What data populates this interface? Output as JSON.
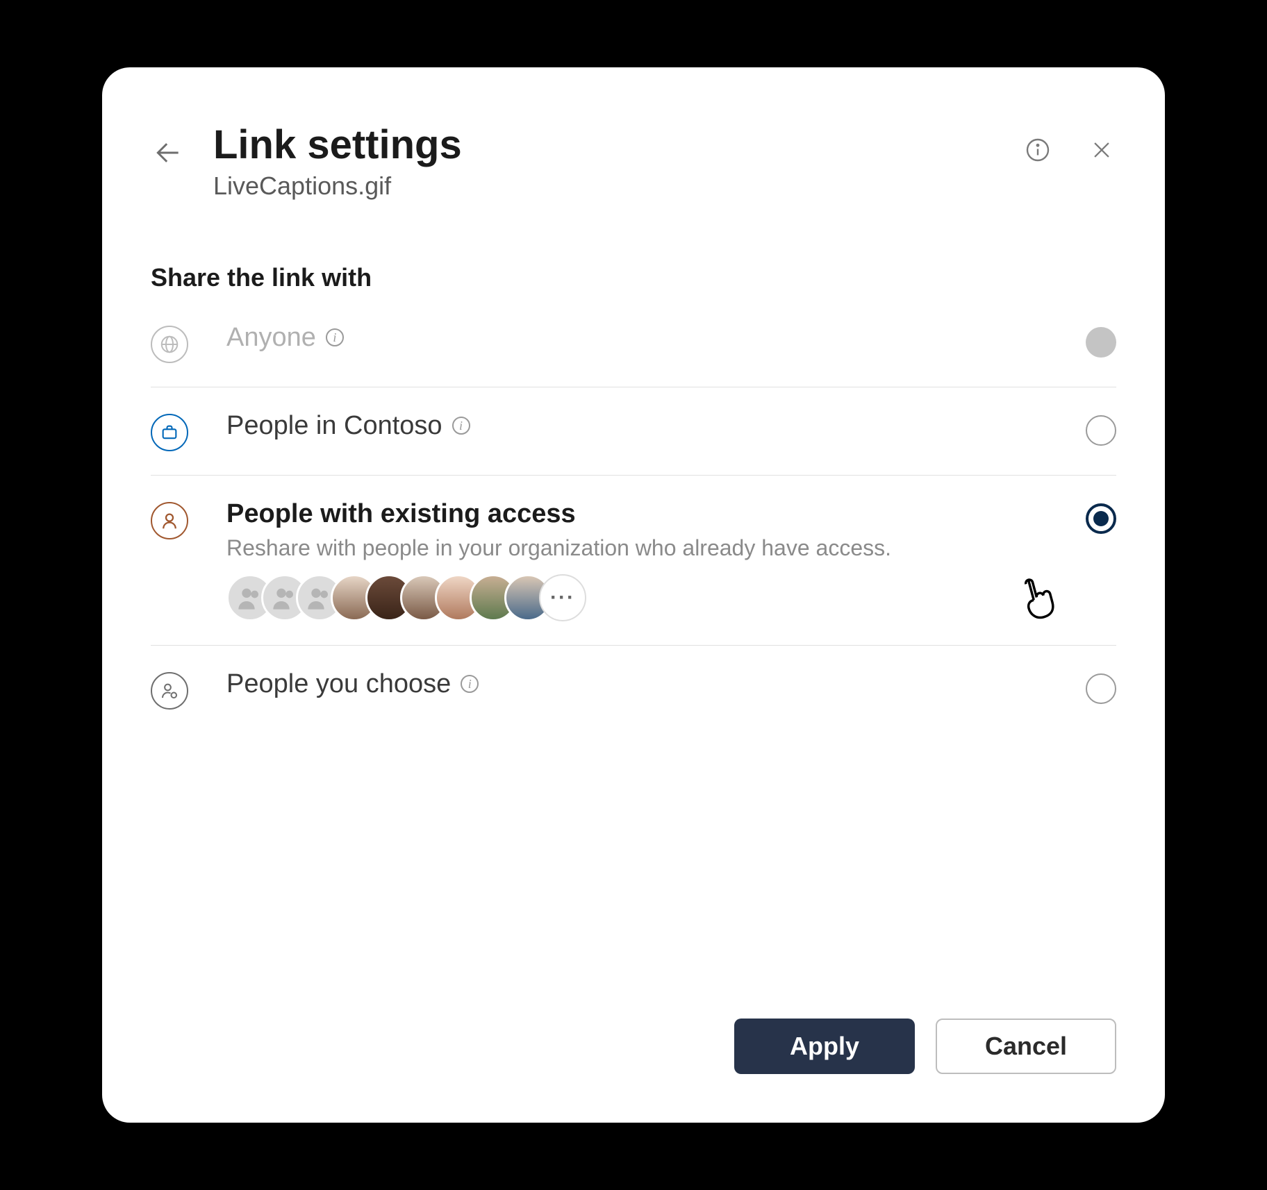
{
  "header": {
    "title": "Link settings",
    "filename": "LiveCaptions.gif"
  },
  "section_label": "Share the link with",
  "options": {
    "anyone": {
      "label": "Anyone",
      "icon_color": "#bcbcbc",
      "state": "disabled"
    },
    "org": {
      "label": "People in Contoso",
      "icon_color": "#0067b8",
      "state": "unselected"
    },
    "existing": {
      "label": "People with existing access",
      "description": "Reshare with people in your organization who already have access.",
      "icon_color": "#a0572e",
      "state": "selected",
      "avatar_overflow": "···"
    },
    "choose": {
      "label": "People you choose",
      "icon_color": "#6e6e6e",
      "state": "unselected"
    }
  },
  "buttons": {
    "apply": "Apply",
    "cancel": "Cancel"
  },
  "colors": {
    "primary_button": "#27334a",
    "accent_radio": "#0a2a4d"
  }
}
